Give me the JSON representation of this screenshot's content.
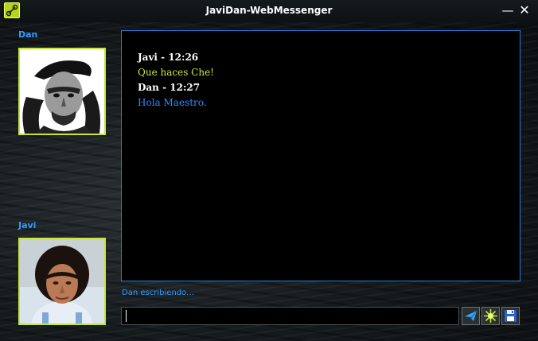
{
  "window": {
    "title": "JaviDan-WebMessenger",
    "minimize_glyph": "—",
    "close_glyph": "✕"
  },
  "users": {
    "top": {
      "name": "Dan",
      "avatar": "avatar-portrait-beret"
    },
    "bottom": {
      "name": "Javi",
      "avatar": "avatar-portrait-curly-hair"
    }
  },
  "messages": [
    {
      "author": "Javi - 12:26",
      "text": "Que haces Che!",
      "color": "#c8ec3a"
    },
    {
      "author": "Dan - 12:27",
      "text": "Hola Maestro.",
      "color": "#2f8cff"
    }
  ],
  "status": {
    "typing": "Dan escribiendo…"
  },
  "composer": {
    "value": ""
  },
  "toolbar": {
    "send": "send-icon",
    "emoticon": "emoticon-icon",
    "save": "save-icon"
  },
  "colors": {
    "accent_blue": "#2f9bff",
    "accent_lime": "#c6e43a",
    "panel_border": "#2a7ad8"
  }
}
